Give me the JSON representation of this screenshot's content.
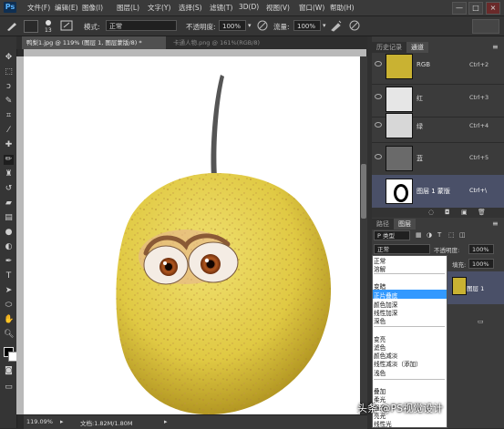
{
  "app": {
    "logo": "Ps"
  },
  "menu": [
    "文件(F)",
    "编辑(E)",
    "图像(I)",
    "图层(L)",
    "文字(Y)",
    "选择(S)",
    "滤镜(T)",
    "3D(D)",
    "视图(V)",
    "窗口(W)",
    "帮助(H)"
  ],
  "window_controls": [
    "—",
    "□",
    "×"
  ],
  "options": {
    "mode_label": "模式:",
    "mode_value": "正常",
    "opacity_label": "不透明度:",
    "opacity_value": "100%",
    "flow_label": "流量:",
    "flow_value": "100%"
  },
  "tabs": {
    "active": "鸭梨1.jpg @ 119% (图层 1, 图层蒙版/8) *",
    "inactive": "卡通人物.png @ 161%(RGB/8)"
  },
  "status": {
    "zoom": "119.09%",
    "doc": "文档:1.82M/1.80M"
  },
  "panel": {
    "top_tabs": [
      "历史记录",
      "通道"
    ],
    "channels": [
      {
        "name": "RGB",
        "shortcut": "Ctrl+2"
      },
      {
        "name": "红",
        "shortcut": "Ctrl+3"
      },
      {
        "name": "绿",
        "shortcut": "Ctrl+4"
      },
      {
        "name": "蓝",
        "shortcut": "Ctrl+5"
      },
      {
        "name": "图层 1 蒙版",
        "shortcut": "Ctrl+\\"
      }
    ],
    "layer_tabs": [
      "路径",
      "图层"
    ],
    "filter_kind": "P 类型",
    "blend_mode": "正常",
    "opacity_label": "不透明度:",
    "opacity_value": "100%",
    "fill_label": "填充:",
    "fill_value": "100%",
    "layer_name": "图层 1"
  },
  "blend_menu": {
    "groups": [
      [
        "正常",
        "溶解"
      ],
      [
        "变暗",
        "正片叠底",
        "颜色加深",
        "线性加深",
        "深色"
      ],
      [
        "变亮",
        "滤色",
        "颜色减淡",
        "线性减淡（添加）",
        "浅色"
      ],
      [
        "叠加",
        "柔光",
        "强光",
        "亮光",
        "线性光"
      ]
    ],
    "selected": "正片叠底"
  },
  "watermark": "头条 @PS视觉设计",
  "colors": {
    "pear": "#e3cf47",
    "pear_dark": "#a98c1b",
    "select": "#3399ff",
    "ui_bg": "#2b2b2b"
  }
}
